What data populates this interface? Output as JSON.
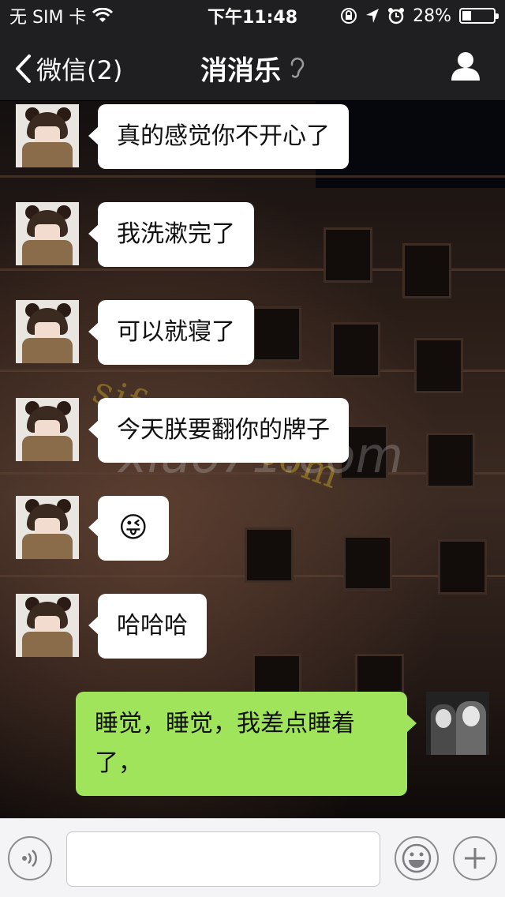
{
  "status_bar": {
    "carrier": "无 SIM 卡",
    "time": "下午11:48",
    "battery": "28%",
    "battery_level": 0.28
  },
  "nav": {
    "back_label": "微信(2)",
    "title": "消消乐"
  },
  "messages": [
    {
      "from": "other",
      "text": "真的感觉你不开心了"
    },
    {
      "from": "other",
      "text": "我洗漱完了"
    },
    {
      "from": "other",
      "text": "可以就寝了"
    },
    {
      "from": "other",
      "text": "今天朕要翻你的牌子"
    },
    {
      "from": "other",
      "text": "😜"
    },
    {
      "from": "other",
      "text": "哈哈哈"
    },
    {
      "from": "self",
      "text": "睡觉，睡觉，我差点睡着了，"
    }
  ],
  "watermarks": {
    "line1": "sifangtv.com",
    "line2": "xiao71.com"
  },
  "input": {
    "placeholder": "",
    "value": ""
  },
  "colors": {
    "bar_background": "#1f1f21",
    "self_bubble": "#a0e45c",
    "other_bubble": "#ffffff"
  }
}
